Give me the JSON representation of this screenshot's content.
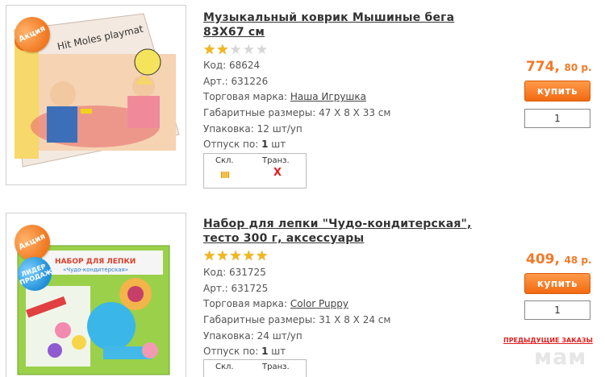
{
  "colors": {
    "accent": "#f07a2a",
    "button": "#f26a12",
    "red": "#e02020",
    "star": "#f2b81b"
  },
  "products": [
    {
      "promo_badge": "Акция",
      "title": "Музыкальный коврик Мышиные бега 83Х67 см",
      "rating": 2,
      "max_rating": 5,
      "code_label": "Код: 68624",
      "art_label": "Арт.: 631226",
      "brand_prefix": "Торговая марка: ",
      "brand": "Наша Игрушка",
      "dims": "Габаритные размеры: 47 X 8 X 33 см",
      "pack": "Упаковка: 12 шт/уп",
      "release_prefix": "Отпуск по: ",
      "release_value": "1",
      "release_unit": " шт",
      "stock_header_1": "Скл.",
      "stock_header_2": "Транз.",
      "stock_warehouse": "llll",
      "stock_transit": "X",
      "price_main": "774,",
      "price_kop": "80 р.",
      "buy_label": "купить",
      "qty": "1"
    },
    {
      "promo_badge": "Акция",
      "leader_badge": "ЛИДЕР ПРОДАЖ",
      "title": "Набор для лепки \"Чудо-кондитерская\", тесто 300 г, аксессуары",
      "rating": 5,
      "max_rating": 5,
      "code_label": "Код: 631725",
      "art_label": "Арт.: 631725",
      "brand_prefix": "Торговая марка: ",
      "brand": "Color Puppy",
      "dims": "Габаритные размеры: 31 X 8 X 24 см",
      "pack": "Упаковка: 24 шт/уп",
      "release_prefix": "Отпуск по: ",
      "release_value": "1",
      "release_unit": " шт",
      "stock_header_1": "Скл.",
      "stock_header_2": "Транз.",
      "price_main": "409,",
      "price_kop": "48 р.",
      "buy_label": "купить",
      "qty": "1"
    }
  ],
  "footer": {
    "prev_orders": "ПРЕДЫДУЩИЕ ЗАКАЗЫ",
    "watermark": "мам"
  }
}
